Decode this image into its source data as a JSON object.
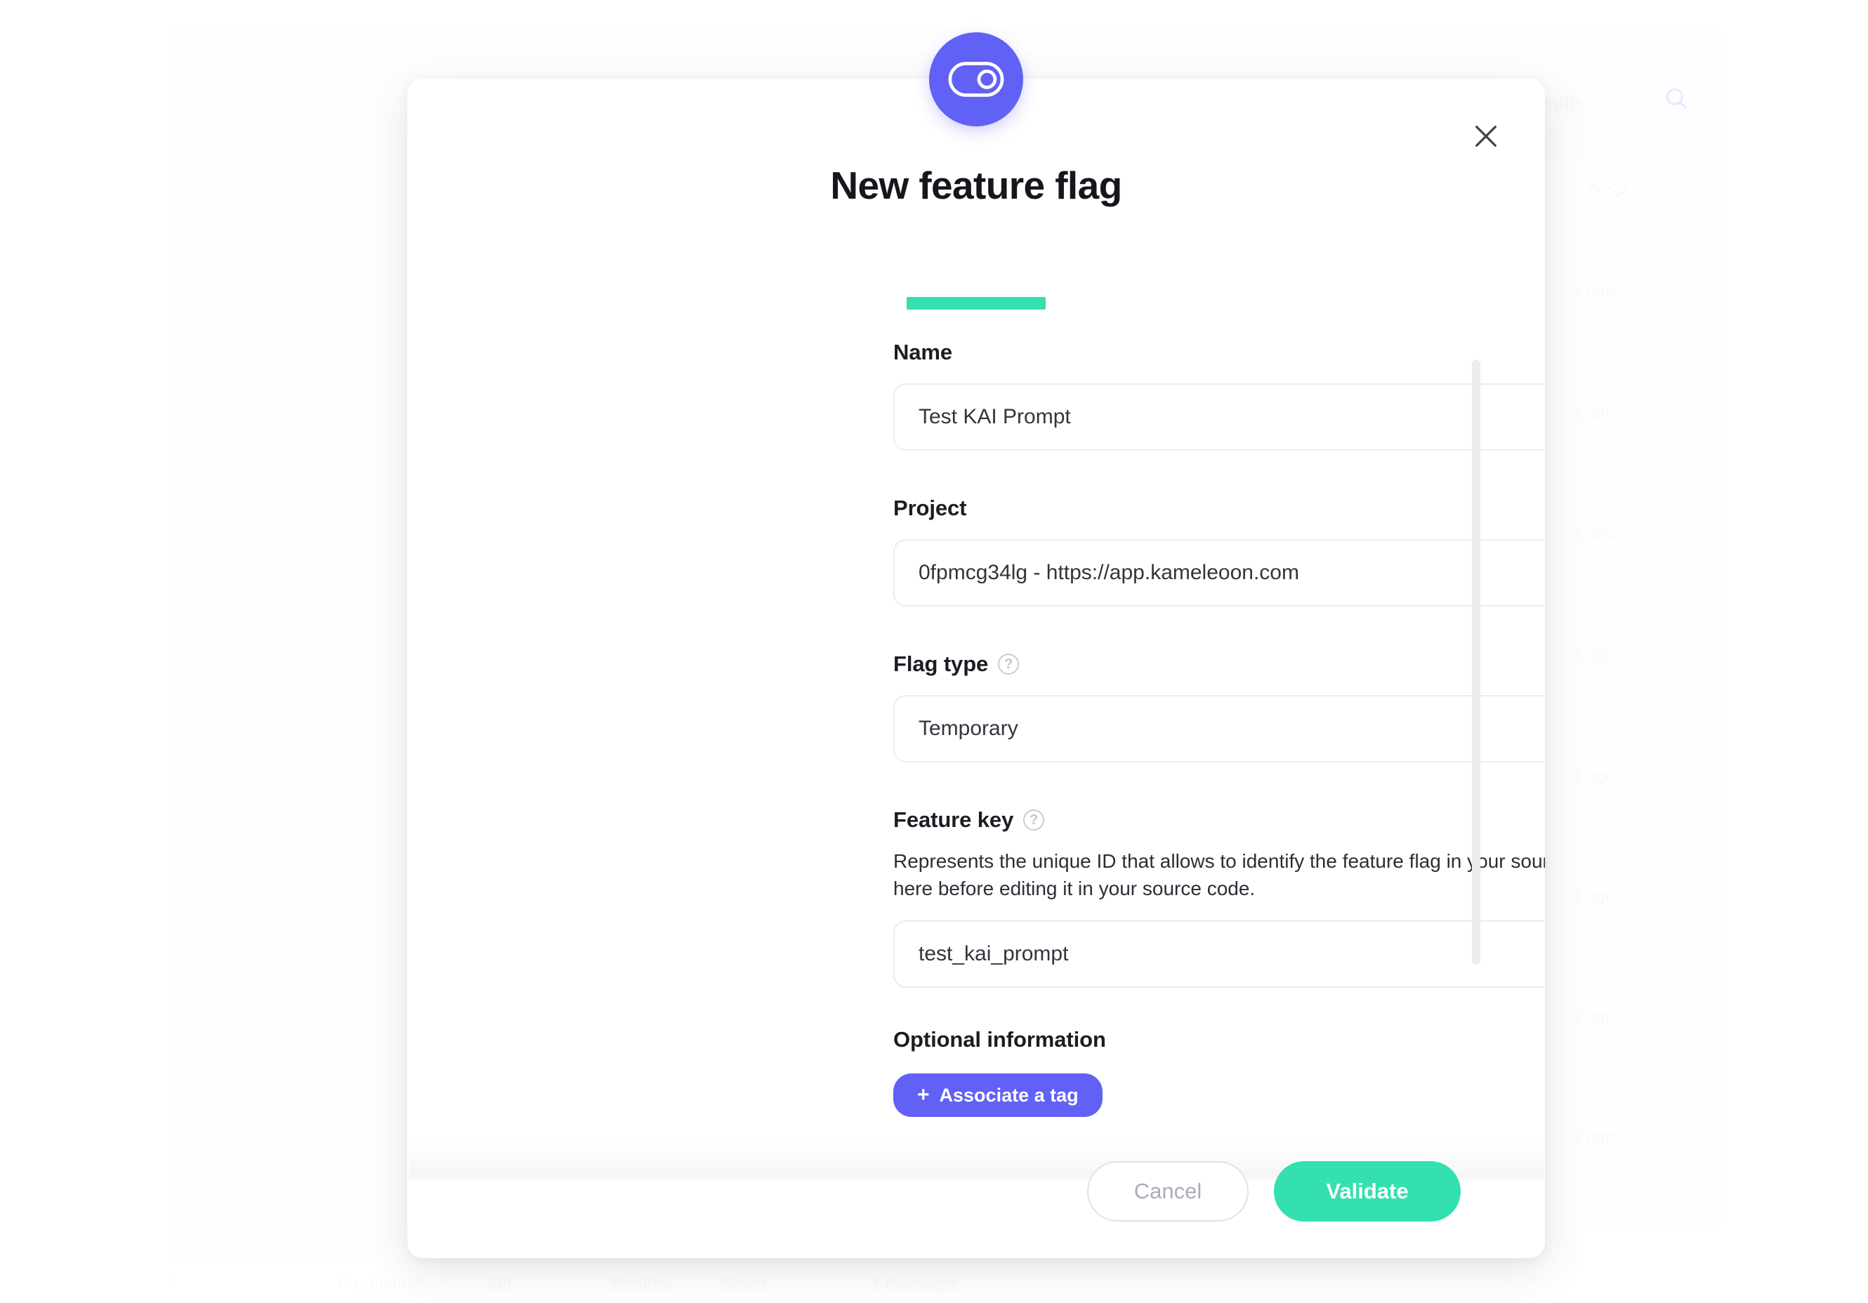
{
  "background": {
    "results_label": "sults",
    "search_icon": "search-icon",
    "filter_label": "D",
    "row_ago_label": "s ago",
    "rows_ago": [
      "s ago",
      "s ago",
      "s ago",
      "s ago",
      "s ago",
      "s ago",
      "s ago",
      "s ago"
    ],
    "bottom_row": {
      "name": "l",
      "environment": "Production",
      "status": "Off",
      "health": "Healthy",
      "last_seen": "Never",
      "updated": "7 days ago"
    }
  },
  "modal": {
    "badge_icon": "toggle-switch-icon",
    "close_icon": "close-icon",
    "title": "New feature flag",
    "accent_green": "#34DFB0",
    "accent_purple": "#6161F5",
    "fields": {
      "name": {
        "label": "Name",
        "value": "Test KAI Prompt",
        "placeholder": "Name"
      },
      "project": {
        "label": "Project",
        "value": "0fpmcg34lg - https://app.kameleoon.com",
        "chevron_icon": "chevron-down-icon"
      },
      "flag_type": {
        "label": "Flag type",
        "help_icon": "help-circle-icon",
        "help_glyph": "?",
        "value": "Temporary",
        "chevron_icon": "chevron-down-icon"
      },
      "feature_key": {
        "label": "Feature key",
        "help_icon": "help-circle-icon",
        "help_glyph": "?",
        "description": "Represents the unique ID that allows to identify the feature flag in your source code. Make sure to update it here before editing it in your source code.",
        "value": "test_kai_prompt",
        "placeholder": "Feature key"
      },
      "optional": {
        "label": "Optional information",
        "tag_button_plus": "+",
        "tag_button_label": "Associate a tag"
      }
    },
    "footer": {
      "cancel_label": "Cancel",
      "validate_label": "Validate"
    }
  }
}
